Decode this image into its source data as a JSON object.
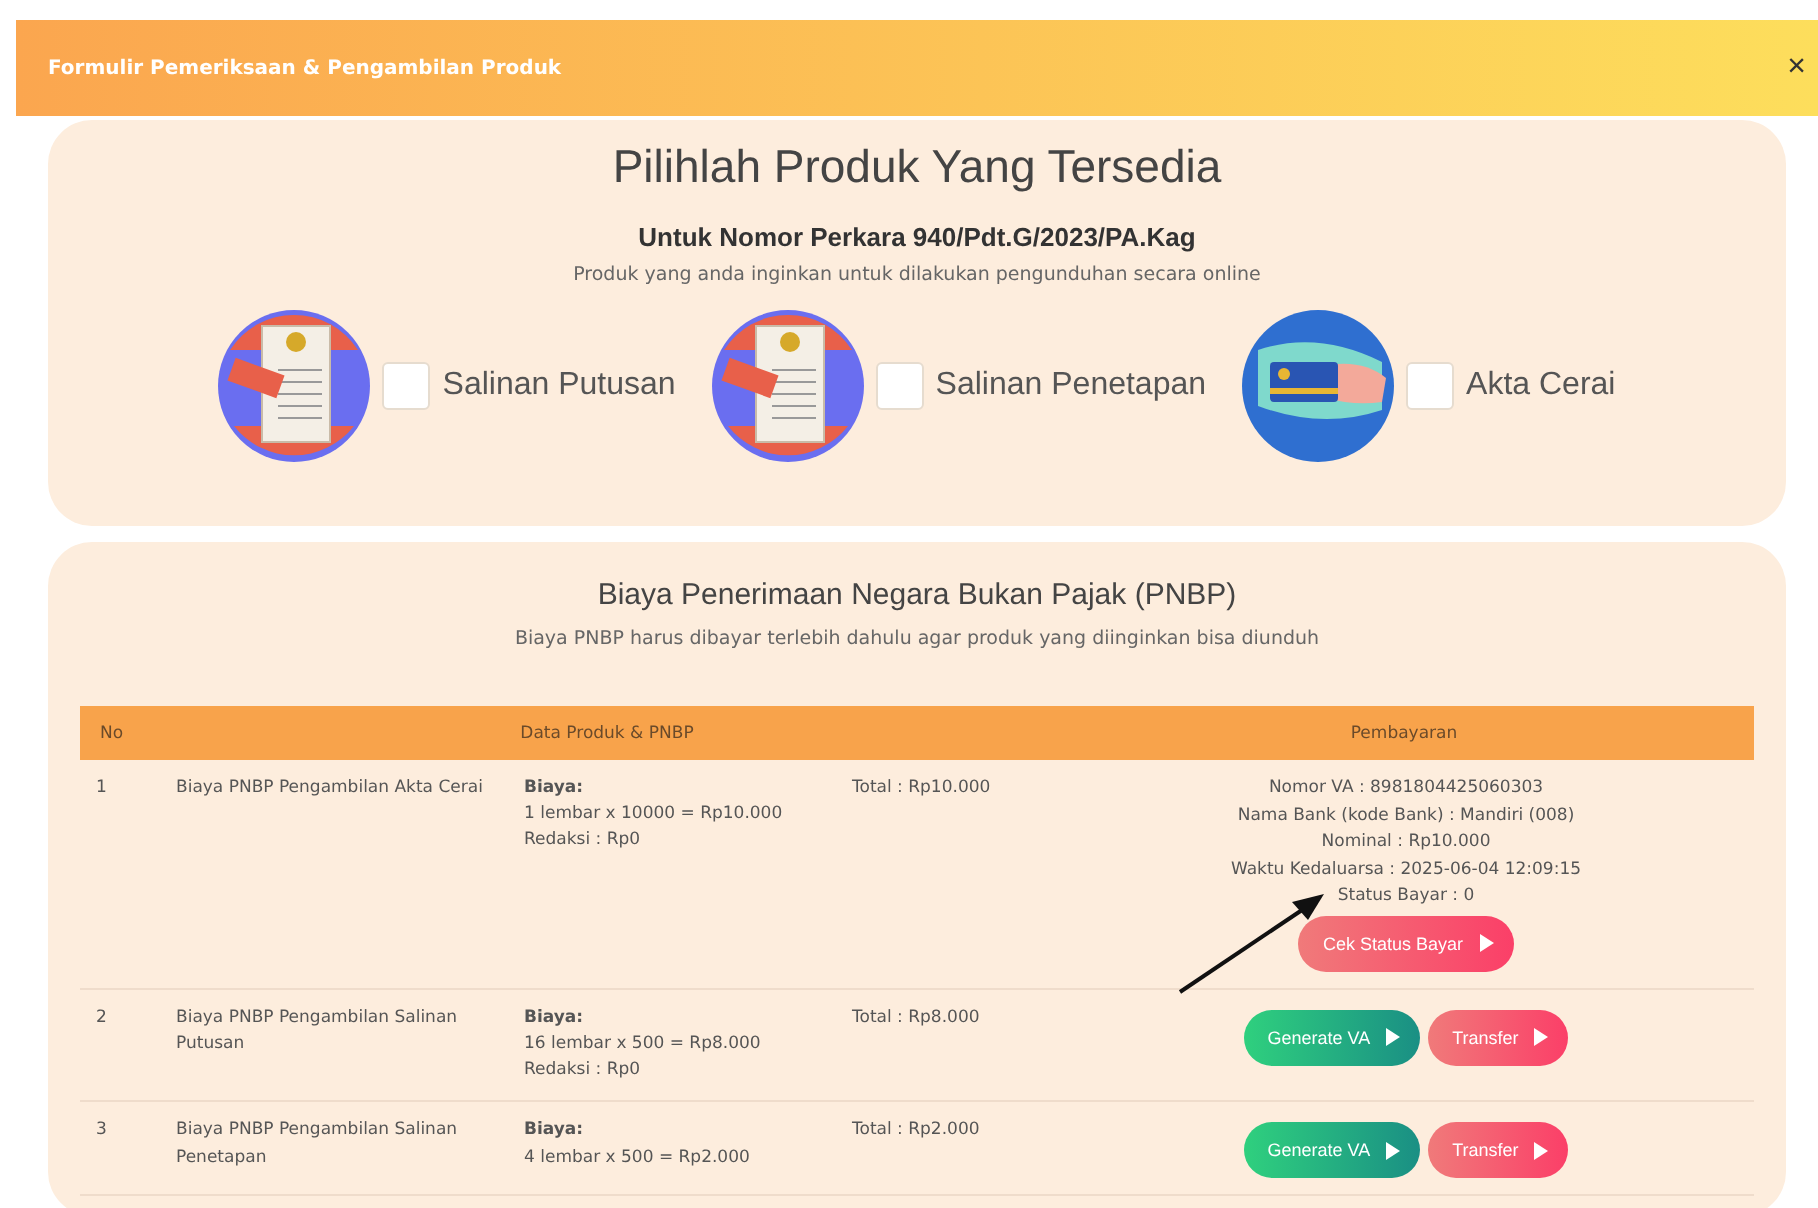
{
  "window": {
    "title": "Formulir Pemeriksaan & Pengambilan Produk",
    "close": "×"
  },
  "products_panel": {
    "title": "Pilihlah Produk Yang Tersedia",
    "case_number": "Untuk Nomor Perkara 940/Pdt.G/2023/PA.Kag",
    "subtitle": "Produk yang anda inginkan untuk dilakukan pengunduhan secara online",
    "products": [
      {
        "label": "Salinan Putusan",
        "checked": false,
        "kind": "document"
      },
      {
        "label": "Salinan Penetapan",
        "checked": false,
        "kind": "document"
      },
      {
        "label": "Akta Cerai",
        "checked": false,
        "kind": "card"
      }
    ]
  },
  "pnbp_panel": {
    "title": "Biaya Penerimaan Negara Bukan Pajak (PNBP)",
    "subtitle": "Biaya PNBP harus dibayar terlebih dahulu agar produk yang diinginkan bisa diunduh",
    "table": {
      "columns": [
        "No",
        "Data Produk & PNBP",
        "Pembayaran"
      ],
      "rows": [
        {
          "no": "1",
          "name": "Biaya PNBP Pengambilan Akta Cerai",
          "cost_label": "Biaya:",
          "cost_lines": [
            "1 lembar x 10000 = Rp10.000",
            "Redaksi : Rp0"
          ],
          "total": "Total : Rp10.000",
          "kind": "va",
          "payment_lines": [
            "Nomor VA : 8981804425060303",
            "Nama Bank (kode Bank) : Mandiri (008)",
            "Nominal : Rp10.000",
            "Waktu Kedaluarsa : 2025-06-04 12:09:15",
            "Status Bayar : 0"
          ],
          "buttons": [
            "Cek Status Bayar"
          ]
        },
        {
          "no": "2",
          "name": "Biaya PNBP Pengambilan Salinan Putusan",
          "cost_label": "Biaya:",
          "cost_lines": [
            "16 lembar x 500 = Rp8.000",
            "Redaksi : Rp0"
          ],
          "total": "Total : Rp8.000",
          "kind": "actions",
          "buttons": [
            "Generate VA",
            "Transfer"
          ]
        },
        {
          "no": "3",
          "name": "Biaya PNBP Pengambilan Salinan Penetapan",
          "cost_label": "Biaya:",
          "cost_lines": [
            "4 lembar x 500 = Rp2.000"
          ],
          "total": "Total : Rp2.000",
          "kind": "actions",
          "buttons": [
            "Generate VA",
            "Transfer"
          ]
        }
      ]
    }
  }
}
